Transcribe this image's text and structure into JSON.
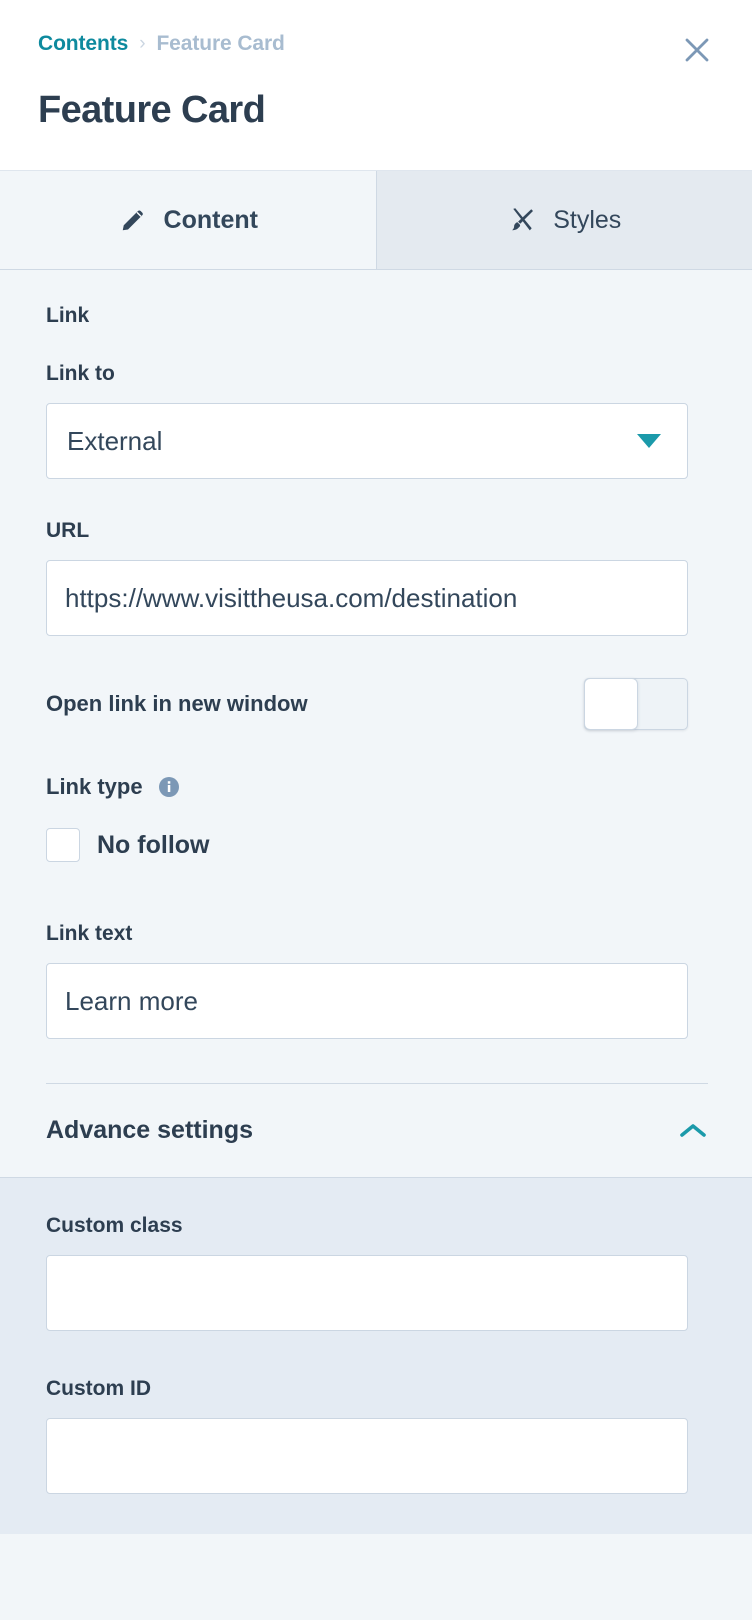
{
  "header": {
    "breadcrumb": {
      "root_label": "Contents",
      "separator": "›",
      "current_label": "Feature Card"
    },
    "title": "Feature Card",
    "close_icon": "close-icon"
  },
  "tabs": [
    {
      "label": "Content",
      "icon": "pencil-icon",
      "active": true
    },
    {
      "label": "Styles",
      "icon": "paintbrush-icon",
      "active": false
    }
  ],
  "content": {
    "group_title": "Link",
    "link_to": {
      "label": "Link to",
      "value": "External",
      "options": [
        "External"
      ],
      "caret_icon": "chevron-down-icon"
    },
    "url": {
      "label": "URL",
      "value": "https://www.visittheusa.com/destination",
      "placeholder": ""
    },
    "open_new_window": {
      "label": "Open link in new window",
      "state": "off"
    },
    "link_type": {
      "label": "Link type",
      "info_icon": "info-icon",
      "no_follow": {
        "label": "No follow",
        "checked": false
      }
    },
    "link_text": {
      "label": "Link text",
      "value": "Learn more",
      "placeholder": ""
    }
  },
  "advance_settings": {
    "title": "Advance settings",
    "expanded": true,
    "chevron_icon": "chevron-up-icon",
    "custom_class": {
      "label": "Custom class",
      "value": "",
      "placeholder": ""
    },
    "custom_id": {
      "label": "Custom ID",
      "value": "",
      "placeholder": ""
    }
  },
  "colors": {
    "accent_teal": "#0e8a9e",
    "caret_teal": "#1b9aaa",
    "text_dark": "#2d3e50",
    "muted_blue": "#a8bcd0",
    "panel_bg": "#f2f6f9",
    "accordion_bg": "#e4ebf3",
    "border": "#cbd6e2"
  }
}
